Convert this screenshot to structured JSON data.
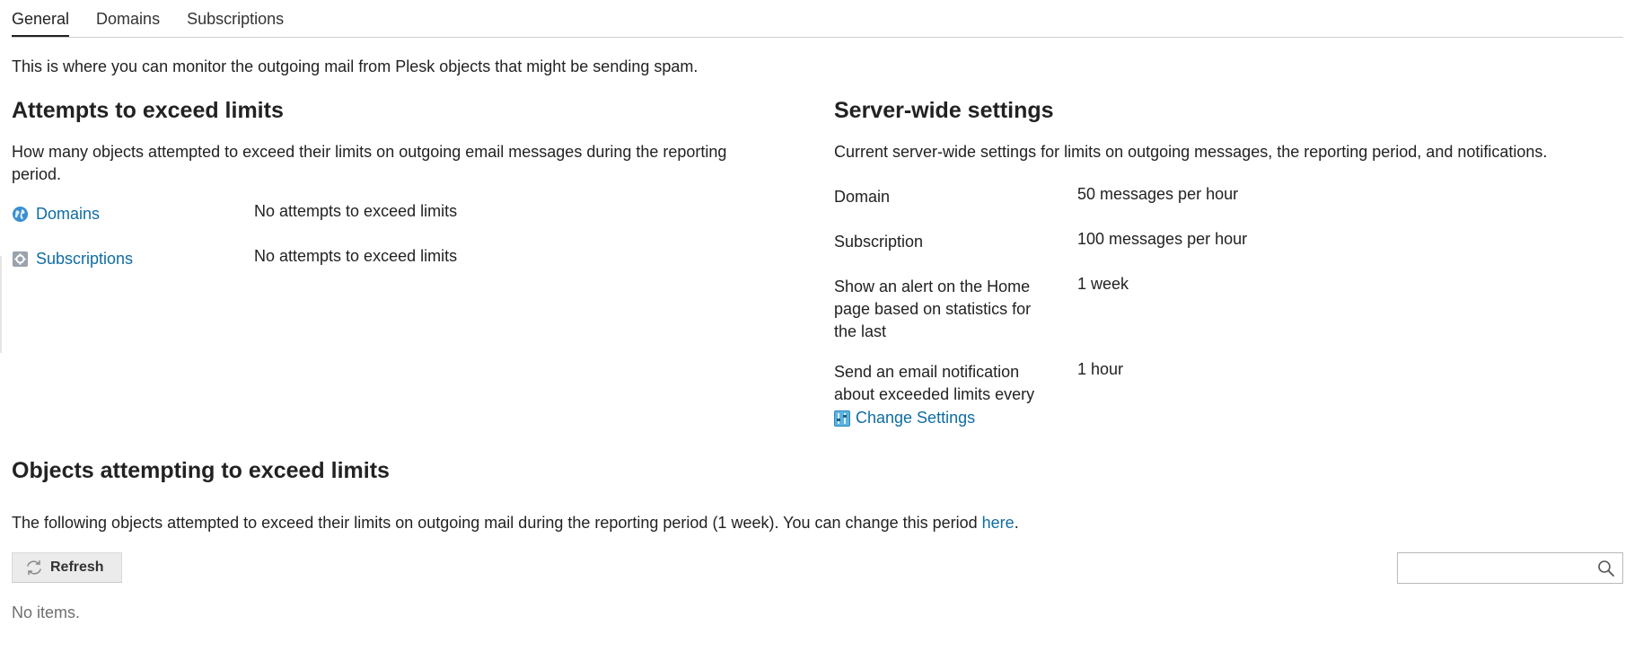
{
  "tabs": [
    {
      "label": "General",
      "active": true
    },
    {
      "label": "Domains",
      "active": false
    },
    {
      "label": "Subscriptions",
      "active": false
    }
  ],
  "intro": "This is where you can monitor the outgoing mail from Plesk objects that might be sending spam.",
  "attempts": {
    "title": "Attempts to exceed limits",
    "description": "How many objects attempted to exceed their limits on outgoing email messages during the reporting period.",
    "rows": [
      {
        "name": "Domains",
        "icon": "globe-icon",
        "value": "No attempts to exceed limits"
      },
      {
        "name": "Subscriptions",
        "icon": "gear-icon",
        "value": "No attempts to exceed limits"
      }
    ]
  },
  "server_settings": {
    "title": "Server-wide settings",
    "description": "Current server-wide settings for limits on outgoing messages, the reporting period, and notifications.",
    "rows": [
      {
        "label": "Domain",
        "value": "50 messages per hour"
      },
      {
        "label": "Subscription",
        "value": "100 messages per hour"
      },
      {
        "label": "Show an alert on the Home page based on statistics for the last",
        "value": "1 week"
      },
      {
        "label": "Send an email notification about exceeded limits every",
        "value": "1 hour"
      }
    ],
    "change_settings_label": "Change Settings"
  },
  "objects": {
    "title": "Objects attempting to exceed limits",
    "description_before": "The following objects attempted to exceed their limits on outgoing mail during the reporting period (1 week). You can change this period ",
    "description_link": "here",
    "description_after": ".",
    "refresh_label": "Refresh",
    "search_placeholder": "",
    "empty_text": "No items."
  },
  "colors": {
    "link": "#0f6da3",
    "text": "#222222",
    "muted": "#6f6f6f",
    "button_bg": "#ebebeb"
  }
}
